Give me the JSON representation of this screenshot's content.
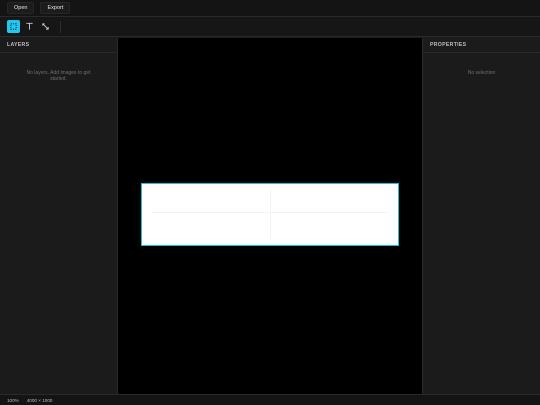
{
  "menubar": {
    "open_label": "Open",
    "export_label": "Export"
  },
  "toolbar": {
    "tools": [
      {
        "icon": "select-icon",
        "active": true
      },
      {
        "icon": "text-icon",
        "active": false
      },
      {
        "icon": "crop-icon",
        "active": false
      }
    ]
  },
  "layers": {
    "header": "LAYERS",
    "empty_message": "No layers. Add images to get started."
  },
  "properties": {
    "header": "PROPERTIES",
    "empty_message": "No selection"
  },
  "status": {
    "zoom": "100%",
    "dimensions": "4000 × 1000"
  },
  "colors": {
    "accent": "#22c7f0",
    "selection_border": "#16c4d8",
    "canvas_background": "#000000",
    "panel_background": "#1b1b1b"
  }
}
